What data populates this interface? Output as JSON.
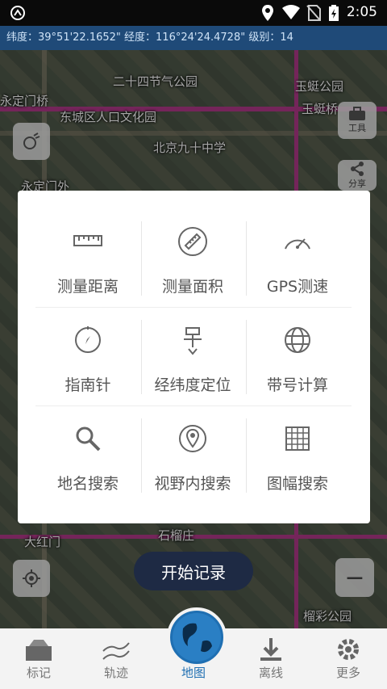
{
  "status_bar": {
    "time": "2:05"
  },
  "coord_bar": {
    "text": "纬度：39°51'22.1652\"  经度：116°24'24.4728\"  级别：14"
  },
  "map": {
    "labels": {
      "l1": "二十四节气公园",
      "l2": "玉蜓公园",
      "l3": "永定门桥",
      "l4": "东城区人口文化园",
      "l5": "玉蜓桥",
      "l6": "北京九十中学",
      "l7": "永定门外",
      "l8": "石榴庄",
      "l9": "大红门",
      "l10": "榴彩公园"
    },
    "tool_label": "工具",
    "share_label": "分享",
    "zoom_out": "−"
  },
  "dialog": {
    "items": [
      {
        "label": "测量距离",
        "icon": "ruler-icon"
      },
      {
        "label": "测量面积",
        "icon": "area-ruler-icon"
      },
      {
        "label": "GPS测速",
        "icon": "speedometer-icon"
      },
      {
        "label": "指南针",
        "icon": "compass-icon"
      },
      {
        "label": "经纬度定位",
        "icon": "pin-locate-icon"
      },
      {
        "label": "带号计算",
        "icon": "globe-grid-icon"
      },
      {
        "label": "地名搜索",
        "icon": "search-icon"
      },
      {
        "label": "视野内搜索",
        "icon": "location-pin-icon"
      },
      {
        "label": "图幅搜索",
        "icon": "grid-icon"
      }
    ]
  },
  "start_record": "开始记录",
  "nav": {
    "items": [
      {
        "label": "标记",
        "icon": "marker-icon"
      },
      {
        "label": "轨迹",
        "icon": "track-icon"
      },
      {
        "label": "地图",
        "icon": "globe-icon",
        "active": true
      },
      {
        "label": "离线",
        "icon": "download-icon"
      },
      {
        "label": "更多",
        "icon": "gear-icon"
      }
    ]
  },
  "colors": {
    "accent": "#1f6fb2",
    "coord_bar": "#1f4a78",
    "start_button": "#1e2a44"
  }
}
